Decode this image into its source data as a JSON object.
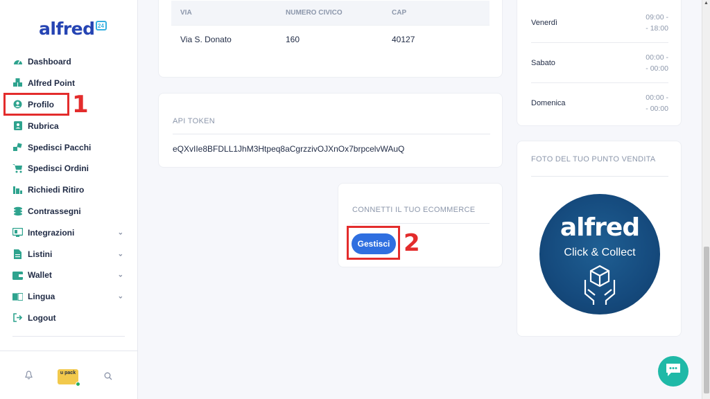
{
  "brand": {
    "logo": "alfred",
    "badge": "24"
  },
  "sidebar": {
    "items": [
      {
        "label": "Dashboard",
        "icon": "dashboard-icon"
      },
      {
        "label": "Alfred Point",
        "icon": "boxes-icon"
      },
      {
        "label": "Profilo",
        "icon": "user-circle-icon"
      },
      {
        "label": "Rubrica",
        "icon": "address-book-icon"
      },
      {
        "label": "Spedisci Pacchi",
        "icon": "packages-icon"
      },
      {
        "label": "Spedisci Ordini",
        "icon": "cart-icon"
      },
      {
        "label": "Richiedi Ritiro",
        "icon": "pickup-icon"
      },
      {
        "label": "Contrassegni",
        "icon": "coins-icon"
      },
      {
        "label": "Integrazioni",
        "icon": "plug-icon"
      },
      {
        "label": "Listini",
        "icon": "file-icon"
      },
      {
        "label": "Wallet",
        "icon": "wallet-icon"
      },
      {
        "label": "Lingua",
        "icon": "language-icon"
      },
      {
        "label": "Logout",
        "icon": "logout-icon"
      }
    ],
    "upack": "u pack"
  },
  "annotations": {
    "one": "1",
    "two": "2"
  },
  "address": {
    "headers": [
      "VIA",
      "NUMERO CIVICO",
      "CAP"
    ],
    "row": [
      "Via S. Donato",
      "160",
      "40127"
    ]
  },
  "api": {
    "title": "API TOKEN",
    "token": "eQXvIIe8BFDLL1JhM3Htpeq8aCgrzzivOJXnOx7brpcelvWAuQ"
  },
  "ecommerce": {
    "title": "CONNETTI IL TUO ECOMMERCE",
    "button": "Gestisci"
  },
  "hours": [
    {
      "day": "Venerdì",
      "time1": "09:00 -",
      "time2": "- 18:00"
    },
    {
      "day": "Sabato",
      "time1": "00:00 -",
      "time2": "- 00:00"
    },
    {
      "day": "Domenica",
      "time1": "00:00 -",
      "time2": "- 00:00"
    }
  ],
  "foto": {
    "title": "FOTO DEL TUO PUNTO VENDITA",
    "brand": "alfred",
    "subtitle": "Click & Collect"
  },
  "colors": {
    "accent": "#2f6fe0",
    "teal": "#2ea38e",
    "highlight": "#e32c2c",
    "chat": "#1fb9a7"
  }
}
